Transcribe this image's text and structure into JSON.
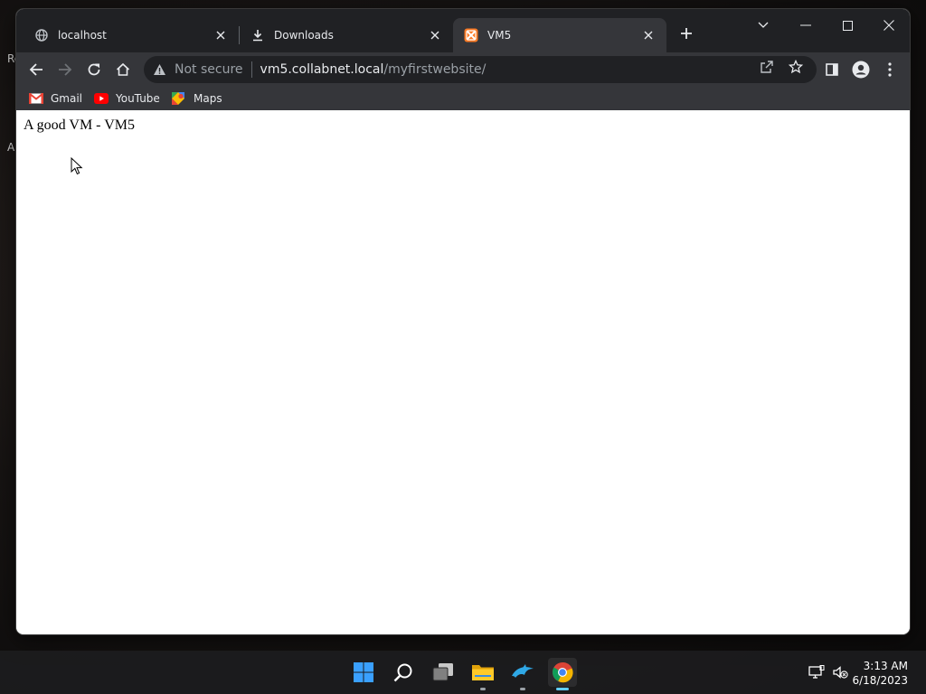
{
  "desktop": {
    "fragments": [
      "Re",
      "A"
    ]
  },
  "browser": {
    "tabs": [
      {
        "title": "localhost",
        "favicon": "globe-icon",
        "active": false
      },
      {
        "title": "Downloads",
        "favicon": "download-icon",
        "active": false
      },
      {
        "title": "VM5",
        "favicon": "xampp-icon",
        "active": true
      }
    ],
    "address": {
      "security_text": "Not secure",
      "host": "vm5.collabnet.local",
      "path": "/myfirstwebsite/"
    },
    "bookmarks": [
      {
        "label": "Gmail",
        "icon": "gmail-icon"
      },
      {
        "label": "YouTube",
        "icon": "youtube-icon"
      },
      {
        "label": "Maps",
        "icon": "maps-icon"
      }
    ],
    "colors": {
      "titlebar": "#202124",
      "toolbar": "#35363a",
      "omnibox": "#202124"
    }
  },
  "page": {
    "text": "A good VM - VM5"
  },
  "taskbar": {
    "time": "3:13 AM",
    "date": "6/18/2023",
    "apps": [
      "windows-start-icon",
      "search-icon",
      "task-view-icon",
      "file-explorer-icon",
      "dolphin-icon",
      "chrome-icon"
    ]
  }
}
